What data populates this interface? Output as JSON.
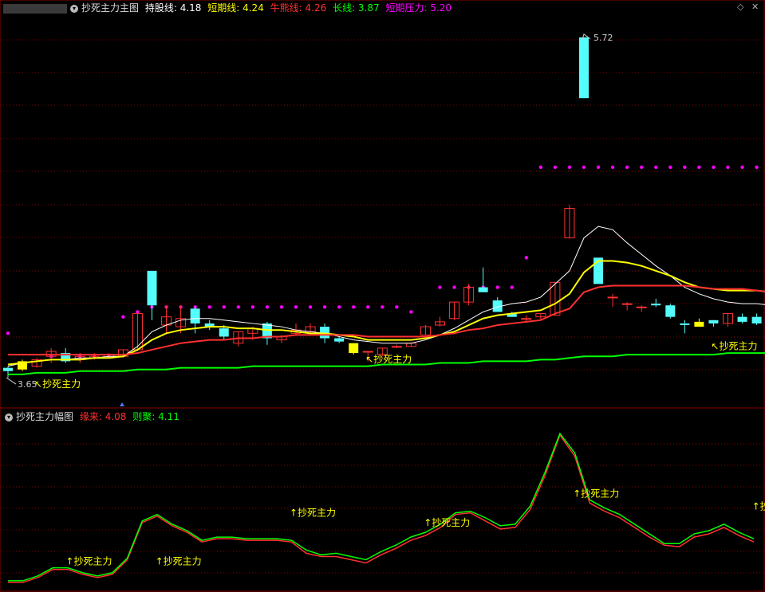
{
  "main_header": {
    "title": "抄死主力主图",
    "items": [
      {
        "label": "持股线: 4.18",
        "color": "#ffffff"
      },
      {
        "label": "短期线: 4.24",
        "color": "#ffff00"
      },
      {
        "label": "牛熊线: 4.26",
        "color": "#ff3030"
      },
      {
        "label": "长线: 3.87",
        "color": "#00ff00"
      },
      {
        "label": "短期压力: 5.20",
        "color": "#ff00ff"
      }
    ]
  },
  "sub_header": {
    "title": "抄死主力幅图",
    "items": [
      {
        "label": "缘来: 4.08",
        "color": "#ff3030"
      },
      {
        "label": "则聚: 4.11",
        "color": "#00ff00"
      }
    ]
  },
  "colors": {
    "up": "#ff3030",
    "down": "#54fcfc",
    "signal": "#ffff00",
    "pressure": "#ff00ff",
    "grid": "#8b0000"
  },
  "chart_data": [
    {
      "type": "candlestick",
      "title": "抄死主力主图",
      "ylim": [
        3.5,
        5.85
      ],
      "max_label": "5.72",
      "min_label": "3.65",
      "candles": [
        [
          3.71,
          3.72,
          3.65,
          3.69
        ],
        [
          3.7,
          3.76,
          3.69,
          3.75
        ],
        [
          3.72,
          3.77,
          3.71,
          3.76
        ],
        [
          3.78,
          3.83,
          3.74,
          3.81
        ],
        [
          3.8,
          3.83,
          3.74,
          3.75
        ],
        [
          3.76,
          3.8,
          3.74,
          3.78
        ],
        [
          3.77,
          3.8,
          3.76,
          3.78
        ],
        [
          3.77,
          3.8,
          3.77,
          3.79
        ],
        [
          3.78,
          3.82,
          3.77,
          3.82
        ],
        [
          3.82,
          4.05,
          3.81,
          4.04
        ],
        [
          4.3,
          4.3,
          4.0,
          4.09
        ],
        [
          3.97,
          4.09,
          3.92,
          4.02
        ],
        [
          3.96,
          4.09,
          3.92,
          4.01
        ],
        [
          4.07,
          4.08,
          3.92,
          3.98
        ],
        [
          3.98,
          4.0,
          3.94,
          3.96
        ],
        [
          3.95,
          3.97,
          3.88,
          3.9
        ],
        [
          3.86,
          3.93,
          3.84,
          3.93
        ],
        [
          3.92,
          3.96,
          3.88,
          3.95
        ],
        [
          3.98,
          3.99,
          3.85,
          3.89
        ],
        [
          3.88,
          3.91,
          3.86,
          3.9
        ],
        [
          3.92,
          3.98,
          3.91,
          3.94
        ],
        [
          3.93,
          3.98,
          3.91,
          3.96
        ],
        [
          3.96,
          3.98,
          3.86,
          3.89
        ],
        [
          3.89,
          3.9,
          3.86,
          3.87
        ],
        [
          3.86,
          3.86,
          3.79,
          3.8
        ],
        [
          3.81,
          3.81,
          3.75,
          3.81
        ],
        [
          3.79,
          3.83,
          3.78,
          3.83
        ],
        [
          3.84,
          3.85,
          3.83,
          3.84
        ],
        [
          3.84,
          3.86,
          3.84,
          3.86
        ],
        [
          3.91,
          3.97,
          3.91,
          3.96
        ],
        [
          3.97,
          4.02,
          3.96,
          3.99
        ],
        [
          4.01,
          4.11,
          4.0,
          4.11
        ],
        [
          4.11,
          4.22,
          4.09,
          4.2
        ],
        [
          4.2,
          4.32,
          4.17,
          4.17
        ],
        [
          4.12,
          4.14,
          4.05,
          4.05
        ],
        [
          4.04,
          4.05,
          4.02,
          4.02
        ],
        [
          4.01,
          4.03,
          3.99,
          4.01
        ],
        [
          4.02,
          4.04,
          4.0,
          4.04
        ],
        [
          4.03,
          4.23,
          4.03,
          4.23
        ],
        [
          4.5,
          4.7,
          4.5,
          4.68
        ],
        [
          5.72,
          5.72,
          5.35,
          5.35
        ],
        [
          4.38,
          4.38,
          4.22,
          4.22
        ],
        [
          4.14,
          4.16,
          4.08,
          4.14
        ],
        [
          4.1,
          4.11,
          4.06,
          4.1
        ],
        [
          4.08,
          4.09,
          4.05,
          4.08
        ],
        [
          4.1,
          4.13,
          4.08,
          4.09
        ],
        [
          4.09,
          4.1,
          4.01,
          4.02
        ],
        [
          3.98,
          4.0,
          3.92,
          3.97
        ],
        [
          3.96,
          4.01,
          3.96,
          3.99
        ],
        [
          4.0,
          4.0,
          3.96,
          3.98
        ],
        [
          3.98,
          4.04,
          3.96,
          4.04
        ],
        [
          4.02,
          4.04,
          3.98,
          3.99
        ],
        [
          4.02,
          4.04,
          3.97,
          3.98
        ],
        [
          4.02,
          4.04,
          3.97,
          4.0
        ],
        [
          3.99,
          4.01,
          3.95,
          3.97
        ]
      ],
      "series": [
        {
          "name": "持股线",
          "color": "#ffffff",
          "values": [
            3.72,
            3.74,
            3.75,
            3.76,
            3.76,
            3.77,
            3.77,
            3.78,
            3.78,
            3.84,
            3.93,
            3.97,
            4.0,
            4.01,
            4.01,
            4.0,
            3.99,
            3.98,
            3.97,
            3.96,
            3.94,
            3.93,
            3.92,
            3.9,
            3.88,
            3.87,
            3.86,
            3.86,
            3.86,
            3.88,
            3.91,
            3.95,
            4.0,
            4.05,
            4.08,
            4.1,
            4.11,
            4.14,
            4.22,
            4.3,
            4.5,
            4.57,
            4.55,
            4.47,
            4.4,
            4.33,
            4.27,
            4.2,
            4.16,
            4.13,
            4.11,
            4.1,
            4.1,
            4.09,
            4.09
          ]
        },
        {
          "name": "短期线",
          "color": "#ffff00",
          "values": [
            3.73,
            3.74,
            3.75,
            3.76,
            3.76,
            3.76,
            3.77,
            3.77,
            3.78,
            3.82,
            3.88,
            3.92,
            3.94,
            3.95,
            3.96,
            3.96,
            3.95,
            3.95,
            3.94,
            3.94,
            3.93,
            3.92,
            3.92,
            3.91,
            3.9,
            3.88,
            3.88,
            3.88,
            3.88,
            3.89,
            3.91,
            3.93,
            3.97,
            4.01,
            4.03,
            4.04,
            4.05,
            4.06,
            4.1,
            4.16,
            4.29,
            4.36,
            4.36,
            4.35,
            4.33,
            4.3,
            4.27,
            4.23,
            4.2,
            4.19,
            4.18,
            4.18,
            4.18,
            4.17,
            4.16
          ]
        },
        {
          "name": "牛熊线",
          "color": "#ff3030",
          "values": [
            3.79,
            3.79,
            3.79,
            3.79,
            3.79,
            3.79,
            3.79,
            3.79,
            3.79,
            3.8,
            3.82,
            3.84,
            3.86,
            3.87,
            3.88,
            3.88,
            3.89,
            3.89,
            3.9,
            3.9,
            3.91,
            3.91,
            3.91,
            3.91,
            3.91,
            3.9,
            3.9,
            3.9,
            3.9,
            3.9,
            3.91,
            3.92,
            3.94,
            3.95,
            3.97,
            3.98,
            3.99,
            4.0,
            4.04,
            4.07,
            4.17,
            4.2,
            4.21,
            4.21,
            4.21,
            4.21,
            4.21,
            4.21,
            4.2,
            4.19,
            4.19,
            4.19,
            4.18,
            4.17,
            4.16
          ]
        },
        {
          "name": "长线",
          "color": "#00ff00",
          "values": [
            3.67,
            3.67,
            3.68,
            3.68,
            3.68,
            3.69,
            3.69,
            3.69,
            3.69,
            3.7,
            3.7,
            3.7,
            3.71,
            3.71,
            3.71,
            3.71,
            3.71,
            3.72,
            3.72,
            3.72,
            3.72,
            3.72,
            3.72,
            3.72,
            3.72,
            3.72,
            3.73,
            3.73,
            3.73,
            3.73,
            3.74,
            3.74,
            3.74,
            3.75,
            3.75,
            3.75,
            3.75,
            3.76,
            3.76,
            3.77,
            3.78,
            3.78,
            3.78,
            3.79,
            3.79,
            3.79,
            3.79,
            3.79,
            3.79,
            3.79,
            3.8,
            3.8,
            3.8,
            3.8,
            3.8
          ]
        }
      ],
      "pressure_levels": [
        {
          "from": 0,
          "to": 0,
          "value": 3.92
        },
        {
          "from": 3,
          "to": 7,
          "value": 3.78
        },
        {
          "from": 8,
          "to": 8,
          "value": 4.02
        },
        {
          "from": 9,
          "to": 9,
          "value": 4.05
        },
        {
          "from": 10,
          "to": 26,
          "value": 4.08
        },
        {
          "from": 27,
          "to": 27,
          "value": 4.08
        },
        {
          "from": 28,
          "to": 28,
          "value": 4.05
        },
        {
          "from": 30,
          "to": 35,
          "value": 4.2
        },
        {
          "from": 36,
          "to": 36,
          "value": 4.38
        },
        {
          "from": 37,
          "to": 54,
          "value": 4.93
        }
      ],
      "signal_bars": [
        1,
        24,
        48
      ],
      "annotations": [
        {
          "text": "↖抄死主力",
          "at": 1,
          "value": 3.63
        },
        {
          "text": "↖抄死主力",
          "at": 24,
          "value": 3.78
        },
        {
          "text": "↖抄死主力",
          "at": 48,
          "value": 3.86
        }
      ]
    },
    {
      "type": "line",
      "title": "抄死主力幅图",
      "ylim": [
        0,
        1
      ],
      "series": [
        {
          "name": "缘来",
          "color": "#ff3030",
          "values": [
            0.02,
            0.02,
            0.05,
            0.1,
            0.1,
            0.07,
            0.05,
            0.07,
            0.16,
            0.39,
            0.43,
            0.37,
            0.33,
            0.27,
            0.29,
            0.29,
            0.28,
            0.28,
            0.28,
            0.27,
            0.2,
            0.18,
            0.18,
            0.16,
            0.14,
            0.19,
            0.23,
            0.28,
            0.31,
            0.36,
            0.44,
            0.45,
            0.4,
            0.35,
            0.36,
            0.47,
            0.68,
            0.93,
            0.8,
            0.51,
            0.46,
            0.42,
            0.36,
            0.3,
            0.25,
            0.24,
            0.3,
            0.32,
            0.36,
            0.31,
            0.27
          ]
        },
        {
          "name": "则聚",
          "color": "#00ff00",
          "values": [
            0.03,
            0.03,
            0.06,
            0.11,
            0.11,
            0.08,
            0.06,
            0.08,
            0.17,
            0.4,
            0.44,
            0.38,
            0.34,
            0.28,
            0.3,
            0.3,
            0.29,
            0.29,
            0.29,
            0.28,
            0.22,
            0.19,
            0.2,
            0.18,
            0.16,
            0.21,
            0.25,
            0.3,
            0.33,
            0.38,
            0.45,
            0.46,
            0.42,
            0.37,
            0.38,
            0.49,
            0.7,
            0.94,
            0.82,
            0.53,
            0.48,
            0.44,
            0.38,
            0.32,
            0.26,
            0.26,
            0.32,
            0.34,
            0.38,
            0.33,
            0.29
          ]
        }
      ],
      "annotations": [
        {
          "text": "↑抄死主力",
          "at": 2,
          "value": 0.15
        },
        {
          "text": "↑抄死主力",
          "at": 8,
          "value": 0.15
        },
        {
          "text": "↑抄死主力",
          "at": 17,
          "value": 0.45
        },
        {
          "text": "↑抄死主力",
          "at": 26,
          "value": 0.39
        },
        {
          "text": "↑抄死主力",
          "at": 36,
          "value": 0.57
        },
        {
          "text": "↑抄死主力",
          "at": 48,
          "value": 0.49
        }
      ]
    }
  ]
}
